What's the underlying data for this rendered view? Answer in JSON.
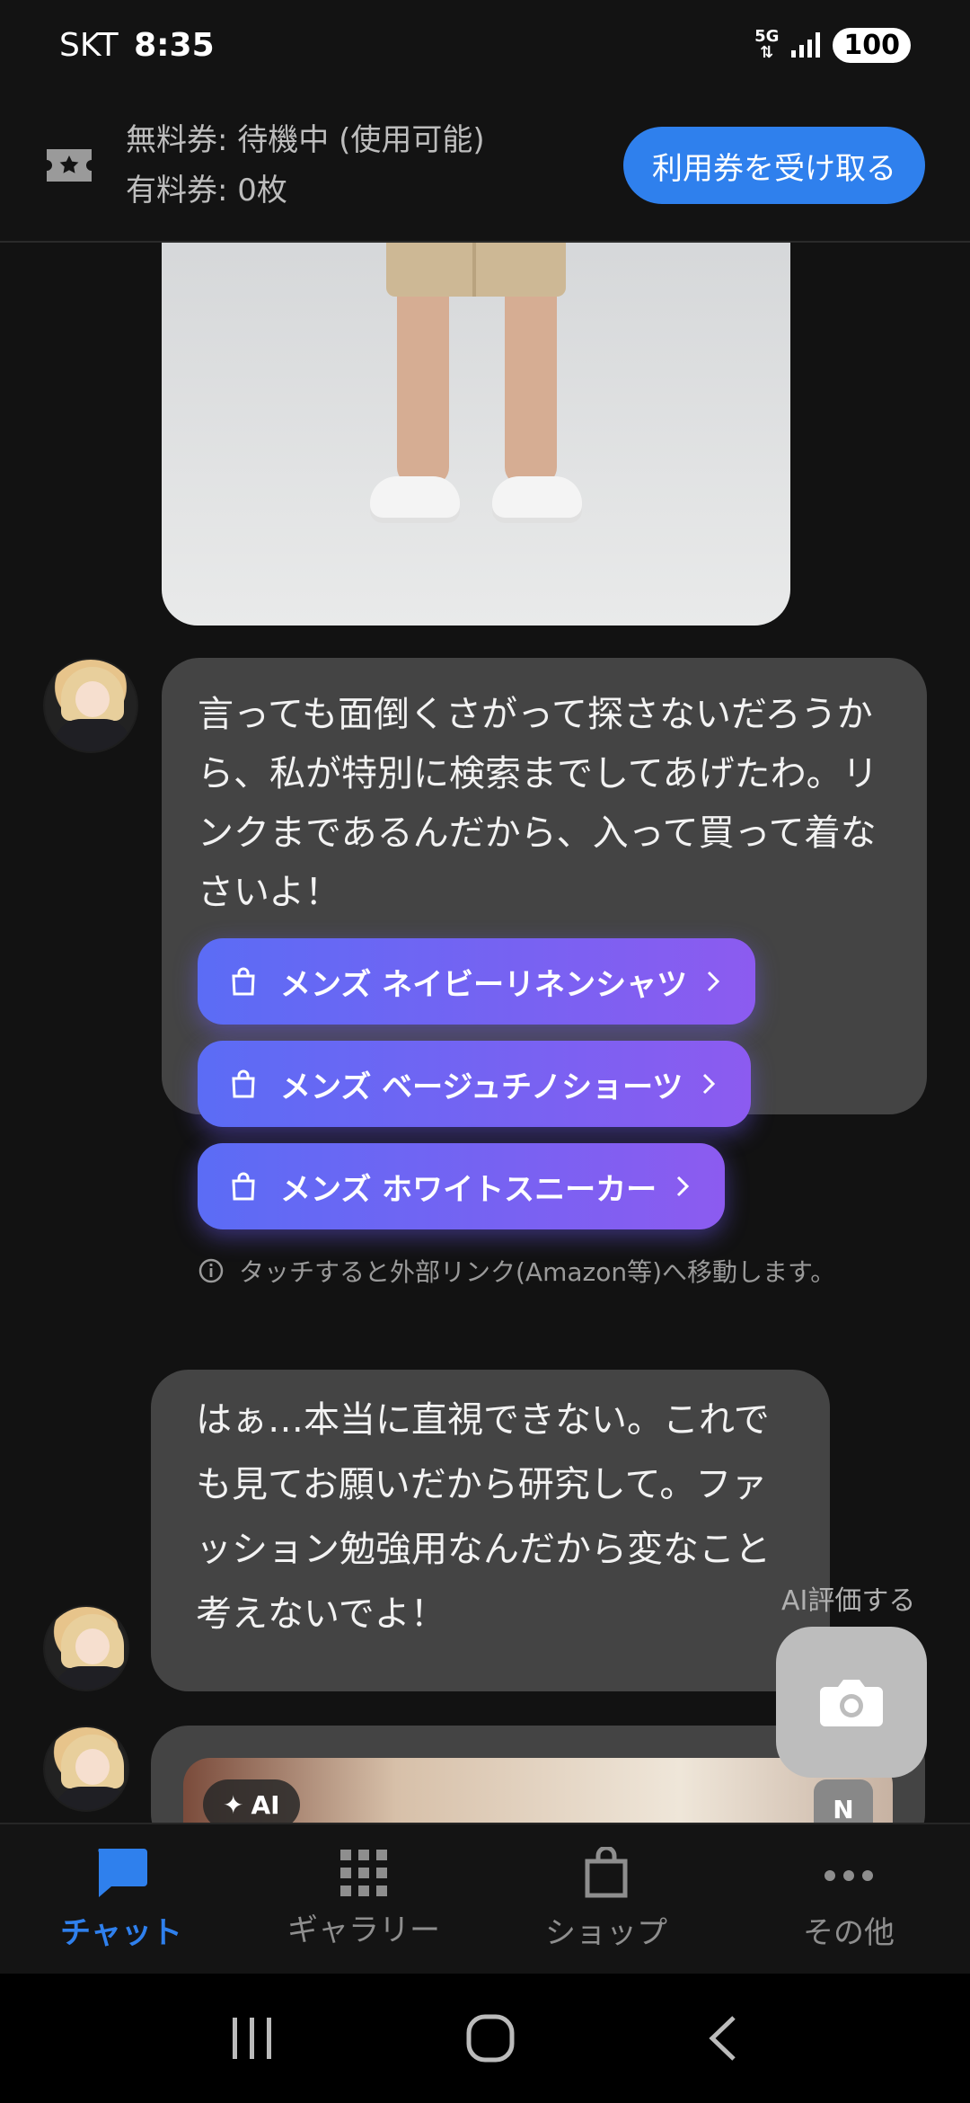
{
  "status_bar": {
    "carrier": "SKT",
    "time": "8:35",
    "network": "5G",
    "battery": "100"
  },
  "ticket_bar": {
    "free_ticket": "無料券: 待機中 (使用可能)",
    "paid_ticket": "有料券: 0枚",
    "receive_button": "利用券を受け取る"
  },
  "messages": {
    "msg1": "言っても面倒くさがって探さないだろうから、私が特別に検索までしてあげたわ。リンクまであるんだから、入って買って着なさいよ！",
    "links": [
      "メンズ ネイビーリネンシャツ",
      "メンズ ベージュチノショーツ",
      "メンズ ホワイトスニーカー"
    ],
    "link_note": "タッチすると外部リンク(Amazon等)へ移動します。",
    "msg2": "はぁ…本当に直視できない。これでも見てお願いだから研究して。ファッション勉強用なんだから変なこと考えないでよ！",
    "ai_badge": "AI",
    "n_badge": "N"
  },
  "fab": {
    "label": "AI評価する"
  },
  "bottom_nav": [
    {
      "label": "チャット",
      "icon": "chat-icon",
      "active": true
    },
    {
      "label": "ギャラリー",
      "icon": "grid-icon",
      "active": false
    },
    {
      "label": "ショップ",
      "icon": "bag-icon",
      "active": false
    },
    {
      "label": "その他",
      "icon": "more-icon",
      "active": false
    }
  ],
  "colors": {
    "accent": "#2f80ed",
    "link_gradient_start": "#5b6cf5",
    "link_gradient_end": "#8c5bf0",
    "bubble": "#444444",
    "background": "#121212"
  }
}
